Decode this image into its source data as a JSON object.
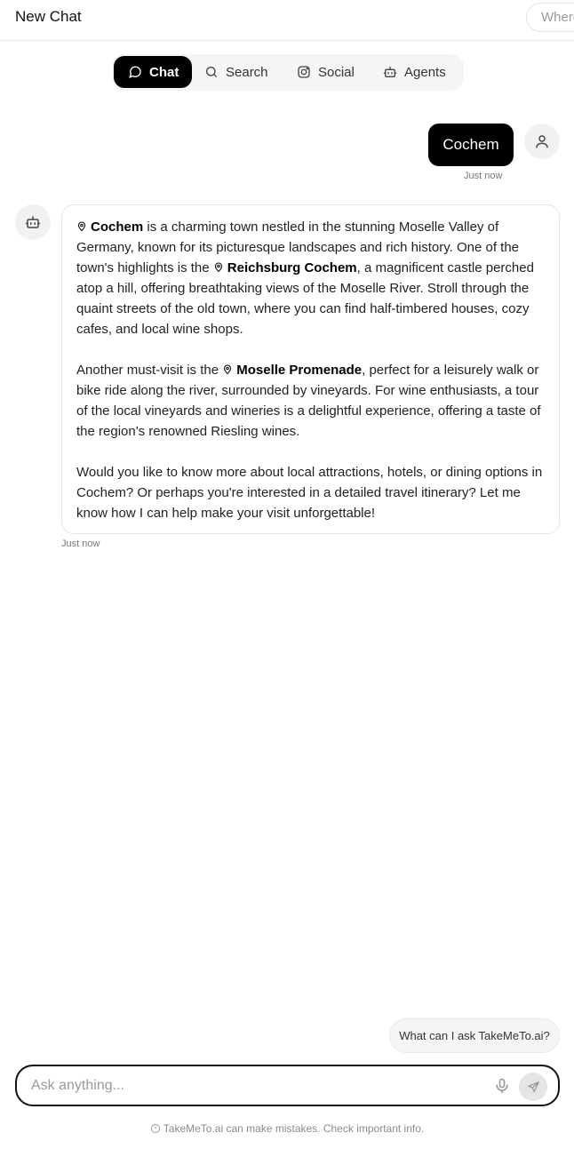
{
  "header": {
    "title": "New Chat",
    "where_placeholder": "Where"
  },
  "tabs": [
    {
      "label": "Chat",
      "icon": "chat-bubble-icon",
      "active": true
    },
    {
      "label": "Search",
      "icon": "search-icon",
      "active": false
    },
    {
      "label": "Social",
      "icon": "instagram-icon",
      "active": false
    },
    {
      "label": "Agents",
      "icon": "robot-icon",
      "active": false
    }
  ],
  "user_message": {
    "text": "Cochem",
    "time": "Just now"
  },
  "bot_message": {
    "time": "Just now",
    "p1": {
      "place1": "Cochem",
      "t1": " is a charming town nestled in the stunning Moselle Valley of Germany, known for its picturesque landscapes and rich history. One of the town's highlights is the ",
      "place2": "Reichsburg Cochem",
      "t2": ", a magnificent castle perched atop a hill, offering breathtaking views of the Moselle River. Stroll through the quaint streets of the old town, where you can find half-timbered houses, cozy cafes, and local wine shops."
    },
    "p2": {
      "t0": "Another must-visit is the ",
      "place": "Moselle Promenade",
      "t1": ", perfect for a leisurely walk or bike ride along the river, surrounded by vineyards. For wine enthusiasts, a tour of the local vineyards and wineries is a delightful experience, offering a taste of the region's renowned Riesling wines."
    },
    "p3": "Would you like to know more about local attractions, hotels, or dining options in Cochem? Or perhaps you're interested in a detailed travel itinerary? Let me know how I can help make your visit unforgettable!"
  },
  "suggestion": "What can I ask TakeMeTo.ai?",
  "composer": {
    "placeholder": "Ask anything..."
  },
  "disclaimer": "TakeMeTo.ai can make mistakes. Check important info."
}
